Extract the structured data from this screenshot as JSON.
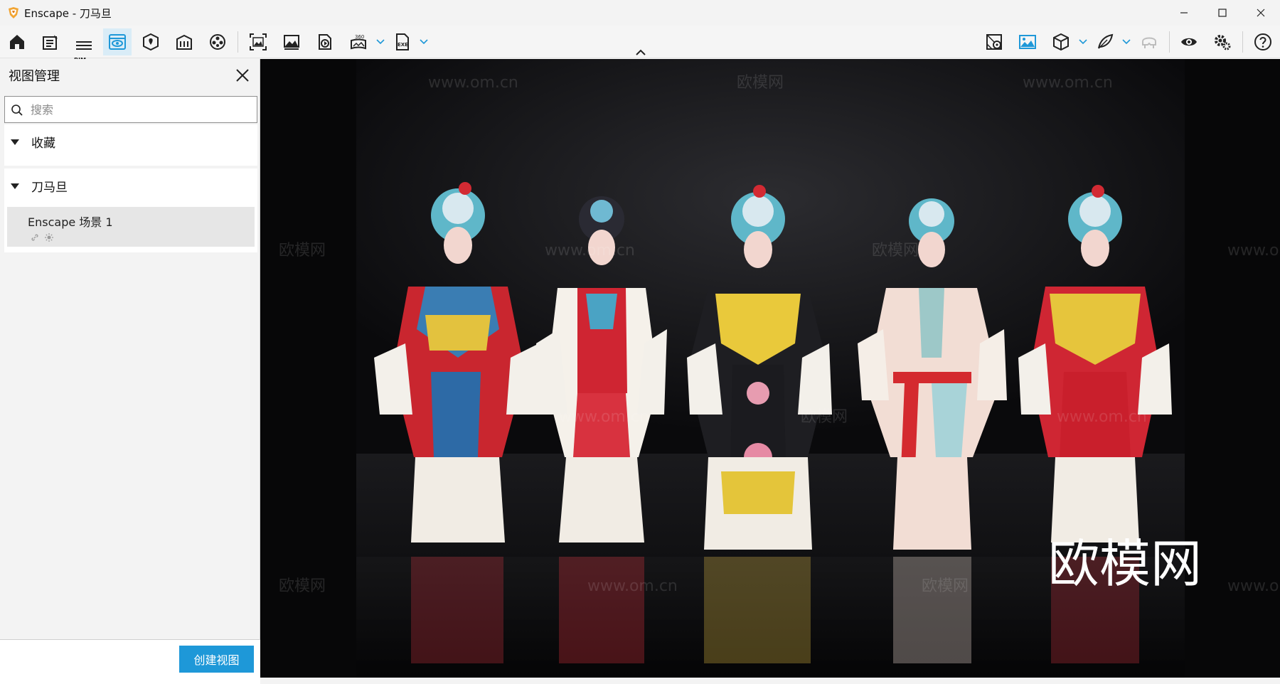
{
  "window": {
    "title": "Enscape - 刀马旦",
    "controls": [
      "minimize-icon",
      "maximize-icon",
      "close-icon"
    ]
  },
  "toolbar": {
    "left_icons": [
      "home-icon",
      "project-notes-icon",
      "bim-list-icon",
      "view-management-icon",
      "site-context-icon",
      "material-library-icon",
      "asset-library-icon",
      "screenshot-icon",
      "batch-render-icon",
      "video-export-icon",
      "panorama-360-icon",
      "exe-export-icon"
    ],
    "bim_label": "BIM",
    "right_icons": [
      "map-icon",
      "image-view-icon",
      "cube-view-icon",
      "feather-tool-icon",
      "vr-headset-icon",
      "visual-settings-icon",
      "settings-icon",
      "help-icon"
    ],
    "active": "view-management-icon"
  },
  "sidebar": {
    "title": "视图管理",
    "search_placeholder": "搜索",
    "groups": [
      {
        "label": "收藏",
        "items": []
      },
      {
        "label": "刀马旦",
        "items": [
          {
            "name": "Enscape 场景 1"
          }
        ]
      }
    ],
    "create_button": "创建视图"
  },
  "viewport": {
    "watermarks": [
      "欧模网",
      "www.om.cn"
    ],
    "brand_mark": "欧模网"
  },
  "colors": {
    "accent": "#1e98d8",
    "active_tab_bg": "#d9ecf7",
    "viewport_bg": "#0d0d0f"
  }
}
